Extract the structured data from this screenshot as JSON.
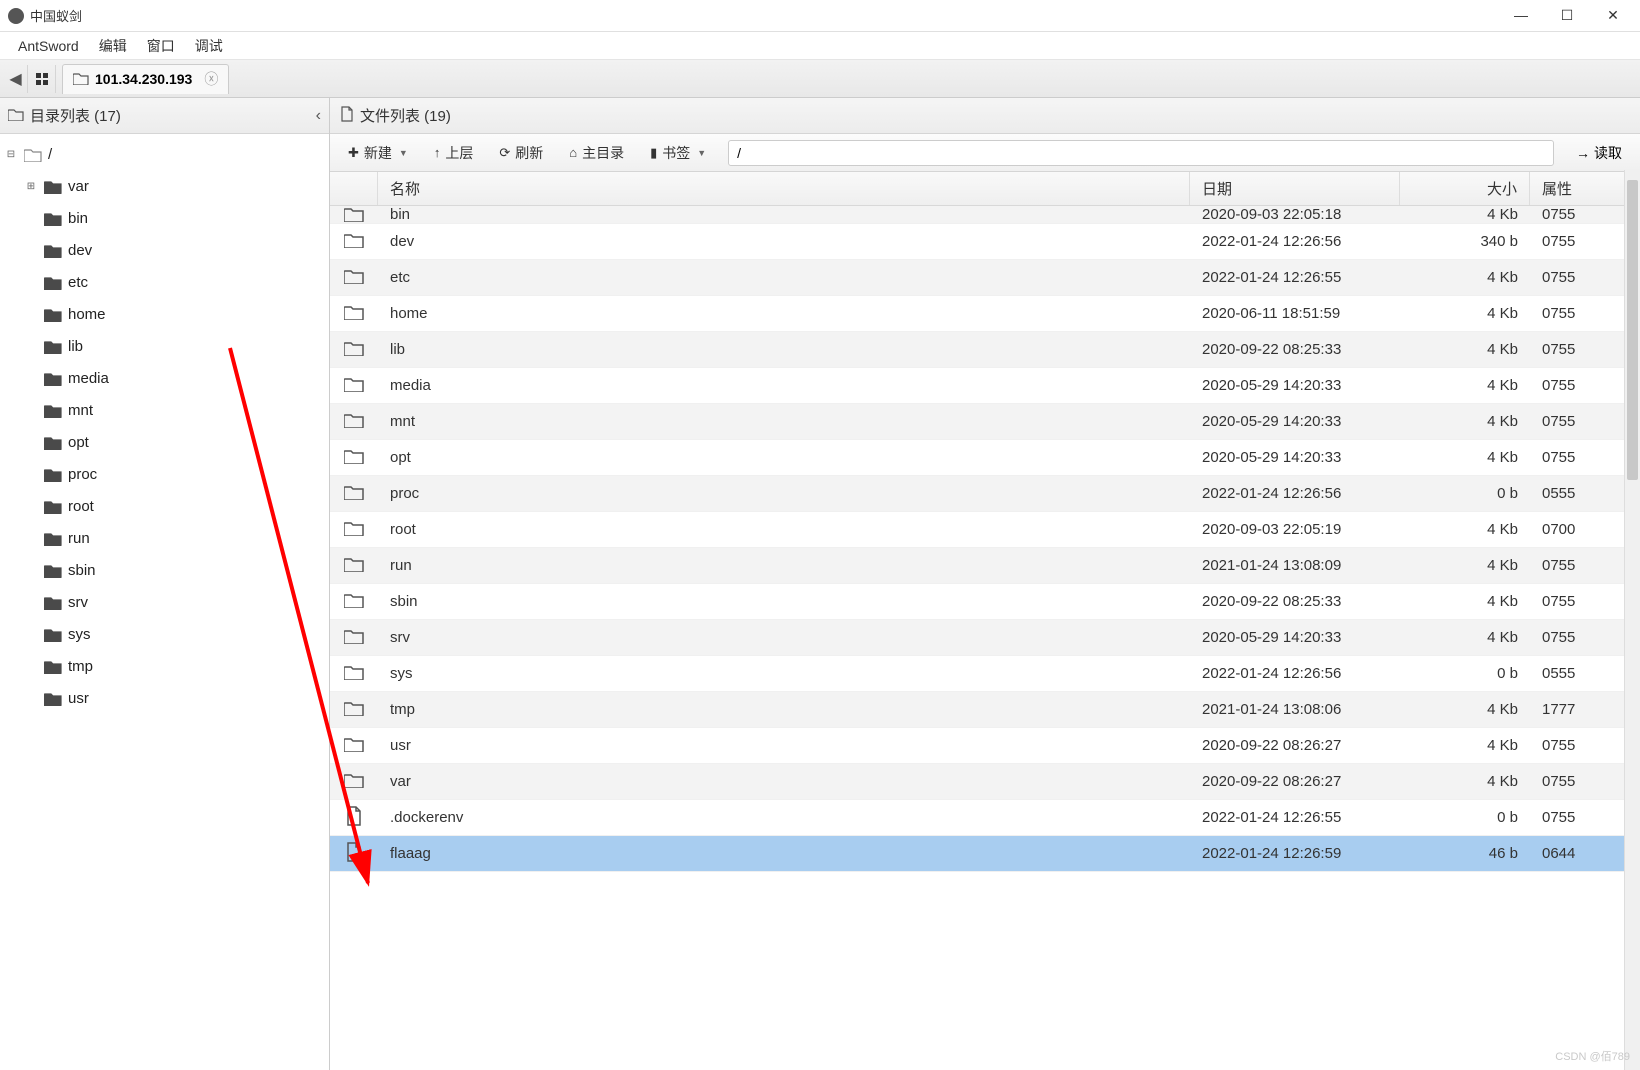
{
  "window": {
    "title": "中国蚁剑",
    "controls": {
      "min": "—",
      "max": "☐",
      "close": "✕"
    }
  },
  "menubar": [
    "AntSword",
    "编辑",
    "窗口",
    "调试"
  ],
  "tab": {
    "label": "101.34.230.193"
  },
  "leftPanel": {
    "title": "目录列表 (17)",
    "root": "/",
    "items": [
      "var",
      "bin",
      "dev",
      "etc",
      "home",
      "lib",
      "media",
      "mnt",
      "opt",
      "proc",
      "root",
      "run",
      "sbin",
      "srv",
      "sys",
      "tmp",
      "usr"
    ]
  },
  "rightPanel": {
    "title": "文件列表 (19)",
    "toolbar": {
      "new": "新建",
      "up": "上层",
      "refresh": "刷新",
      "home": "主目录",
      "bookmark": "书签",
      "read": "读取"
    },
    "pathValue": "/",
    "columns": {
      "name": "名称",
      "date": "日期",
      "size": "大小",
      "attr": "属性"
    },
    "partialRow": {
      "name": "bin",
      "date": "2020-09-03 22:05:18",
      "size": "4 Kb",
      "attr": "0755"
    },
    "rows": [
      {
        "type": "dir",
        "name": "dev",
        "date": "2022-01-24 12:26:56",
        "size": "340 b",
        "attr": "0755",
        "sel": false
      },
      {
        "type": "dir",
        "name": "etc",
        "date": "2022-01-24 12:26:55",
        "size": "4 Kb",
        "attr": "0755",
        "sel": false
      },
      {
        "type": "dir",
        "name": "home",
        "date": "2020-06-11 18:51:59",
        "size": "4 Kb",
        "attr": "0755",
        "sel": false
      },
      {
        "type": "dir",
        "name": "lib",
        "date": "2020-09-22 08:25:33",
        "size": "4 Kb",
        "attr": "0755",
        "sel": false
      },
      {
        "type": "dir",
        "name": "media",
        "date": "2020-05-29 14:20:33",
        "size": "4 Kb",
        "attr": "0755",
        "sel": false
      },
      {
        "type": "dir",
        "name": "mnt",
        "date": "2020-05-29 14:20:33",
        "size": "4 Kb",
        "attr": "0755",
        "sel": false
      },
      {
        "type": "dir",
        "name": "opt",
        "date": "2020-05-29 14:20:33",
        "size": "4 Kb",
        "attr": "0755",
        "sel": false
      },
      {
        "type": "dir",
        "name": "proc",
        "date": "2022-01-24 12:26:56",
        "size": "0 b",
        "attr": "0555",
        "sel": false
      },
      {
        "type": "dir",
        "name": "root",
        "date": "2020-09-03 22:05:19",
        "size": "4 Kb",
        "attr": "0700",
        "sel": false
      },
      {
        "type": "dir",
        "name": "run",
        "date": "2021-01-24 13:08:09",
        "size": "4 Kb",
        "attr": "0755",
        "sel": false
      },
      {
        "type": "dir",
        "name": "sbin",
        "date": "2020-09-22 08:25:33",
        "size": "4 Kb",
        "attr": "0755",
        "sel": false
      },
      {
        "type": "dir",
        "name": "srv",
        "date": "2020-05-29 14:20:33",
        "size": "4 Kb",
        "attr": "0755",
        "sel": false
      },
      {
        "type": "dir",
        "name": "sys",
        "date": "2022-01-24 12:26:56",
        "size": "0 b",
        "attr": "0555",
        "sel": false
      },
      {
        "type": "dir",
        "name": "tmp",
        "date": "2021-01-24 13:08:06",
        "size": "4 Kb",
        "attr": "1777",
        "sel": false
      },
      {
        "type": "dir",
        "name": "usr",
        "date": "2020-09-22 08:26:27",
        "size": "4 Kb",
        "attr": "0755",
        "sel": false
      },
      {
        "type": "dir",
        "name": "var",
        "date": "2020-09-22 08:26:27",
        "size": "4 Kb",
        "attr": "0755",
        "sel": false
      },
      {
        "type": "file",
        "name": ".dockerenv",
        "date": "2022-01-24 12:26:55",
        "size": "0 b",
        "attr": "0755",
        "sel": false
      },
      {
        "type": "file",
        "name": "flaaag",
        "date": "2022-01-24 12:26:59",
        "size": "46 b",
        "attr": "0644",
        "sel": true
      }
    ]
  },
  "watermark": "CSDN @佰789"
}
